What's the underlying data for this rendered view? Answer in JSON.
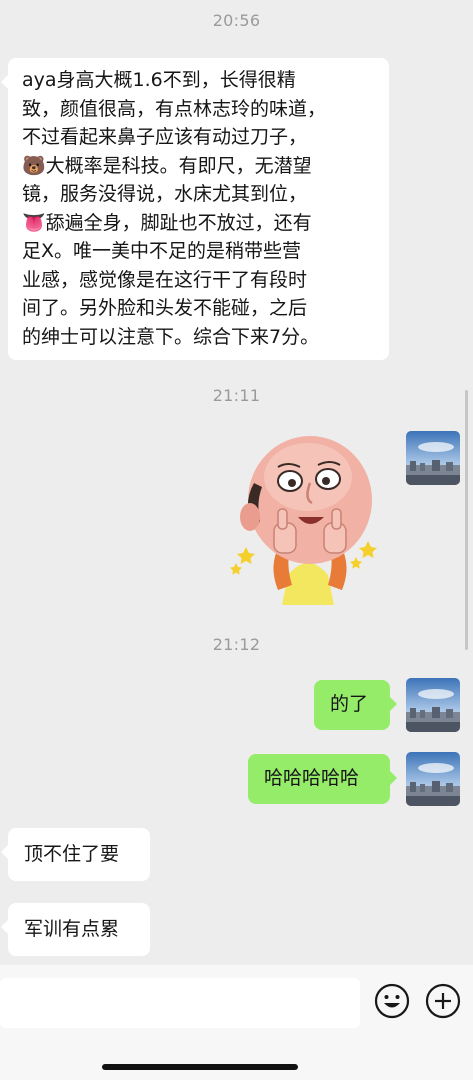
{
  "timestamps": {
    "t1": "20:56",
    "t2": "21:11",
    "t3": "21:12"
  },
  "messages": {
    "m1": "aya身高大概1.6不到，长得很精\n致，颜值很高，有点林志玲的味道，\n不过看起来鼻子应该有动过刀子，\n🐻大概率是科技。有即尺，无潜望\n镜，服务没得说，水床尤其到位，\n👅舔遍全身，脚趾也不放过，还有\n足X。唯一美中不足的是稍带些营\n业感，感觉像是在这行干了有段时\n间了。另外脸和头发不能碰，之后\n的绅士可以注意下。综合下来7分。",
    "m2": "的了",
    "m3": "哈哈哈哈哈",
    "m4": "顶不住了要",
    "m5": "军训有点累"
  },
  "colors": {
    "background": "#ededed",
    "bubble_received": "#ffffff",
    "bubble_sent": "#95ec69",
    "timestamp": "#9a9a9a"
  },
  "icons": {
    "emoji_button": "smiley-face-icon",
    "more_button": "plus-circle-icon",
    "sticker": "bald-man-thumbs-up-sticker",
    "avatar": "cityscape-avatar"
  }
}
